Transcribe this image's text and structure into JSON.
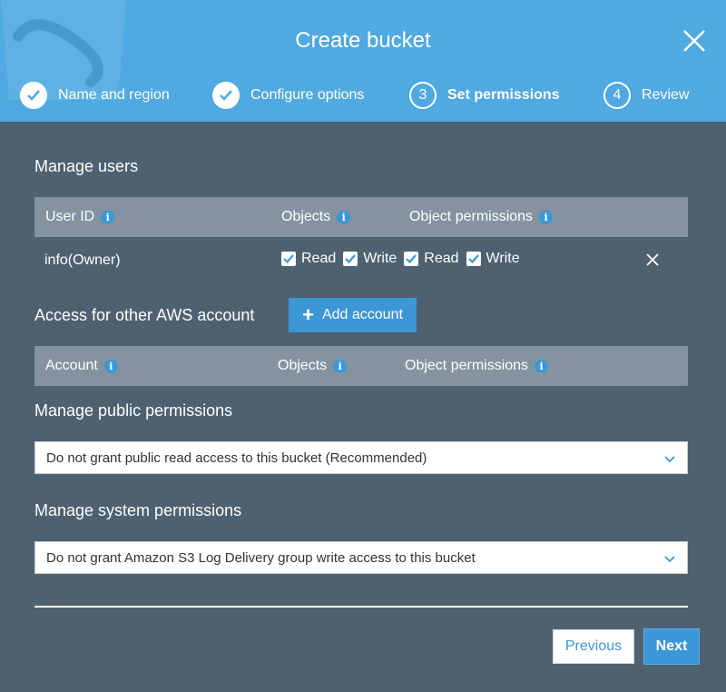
{
  "header": {
    "title": "Create bucket",
    "accent": "#50a9e0",
    "steps": [
      {
        "label": "Name and region",
        "state": "done",
        "number": "1"
      },
      {
        "label": "Configure options",
        "state": "done",
        "number": "2"
      },
      {
        "label": "Set permissions",
        "state": "active",
        "number": "3"
      },
      {
        "label": "Review",
        "state": "pending",
        "number": "4"
      }
    ],
    "close_icon": "close-icon"
  },
  "manage_users": {
    "title": "Manage users",
    "columns": {
      "user_id": "User ID",
      "objects": "Objects",
      "object_permissions": "Object permissions"
    },
    "row": {
      "user": "info(Owner)",
      "objects_read": "Read",
      "objects_write": "Write",
      "perm_read": "Read",
      "perm_write": "Write",
      "objects_read_checked": true,
      "objects_write_checked": true,
      "perm_read_checked": true,
      "perm_write_checked": true
    }
  },
  "other_accounts": {
    "title": "Access for other AWS account",
    "add_button": "Add account",
    "columns": {
      "account": "Account",
      "objects": "Objects",
      "object_permissions": "Object permissions"
    }
  },
  "public_permissions": {
    "title": "Manage public permissions",
    "selected": "Do not grant public read access to this bucket (Recommended)"
  },
  "system_permissions": {
    "title": "Manage system permissions",
    "selected": "Do not grant Amazon S3 Log Delivery group write access to this bucket"
  },
  "footer": {
    "previous": "Previous",
    "next": "Next"
  },
  "colors": {
    "background": "#4e6170",
    "table_header": "#84939f",
    "button_primary": "#3c97d6",
    "info_icon": "#3a98d8"
  }
}
